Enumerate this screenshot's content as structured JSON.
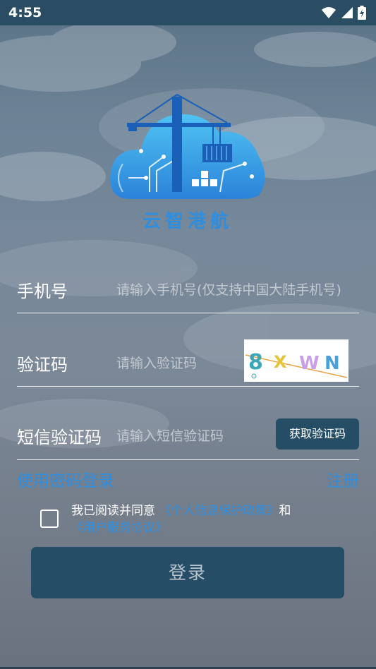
{
  "status_bar": {
    "time": "4:55"
  },
  "brand": {
    "name": "云智港航"
  },
  "form": {
    "phone": {
      "label": "手机号",
      "placeholder": "请输入手机号(仅支持中国大陆手机号)"
    },
    "captcha": {
      "label": "验证码",
      "placeholder": "请输入验证码",
      "image_text": "8XWN"
    },
    "sms": {
      "label": "短信验证码",
      "placeholder": "请输入短信验证码",
      "button": "获取验证码"
    }
  },
  "links": {
    "password_login": "使用密码登录",
    "register": "注册"
  },
  "agreement": {
    "prefix": "我已阅读并同意",
    "privacy_link": "《个人信息保护政策》",
    "and": "和",
    "service_link": "《用户服务协议》"
  },
  "login_button": "登录",
  "colors": {
    "accent": "#2f8ede",
    "button": "#254e66",
    "status_bar": "#2b4d63"
  }
}
